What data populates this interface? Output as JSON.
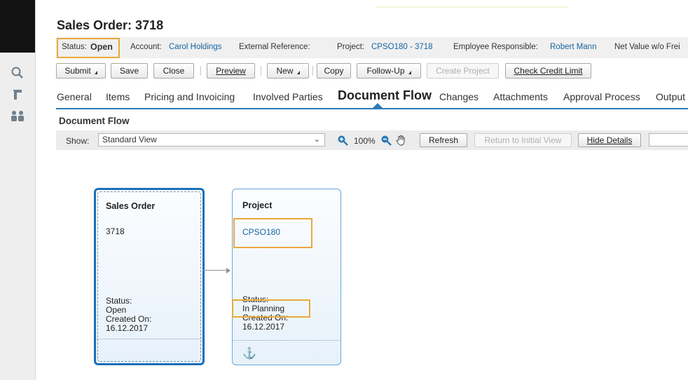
{
  "page": {
    "title": "Sales Order: 3718"
  },
  "status_bar": {
    "status_label": "Status:",
    "status_value": "Open",
    "account_label": "Account:",
    "account_value": "Carol Holdings",
    "external_ref_label": "External Reference:",
    "project_label": "Project:",
    "project_value": "CPSO180 - 3718",
    "employee_label": "Employee Responsible:",
    "employee_value": "Robert Mann",
    "net_value_label": "Net Value w/o Frei"
  },
  "toolbar": {
    "submit": "Submit",
    "save": "Save",
    "close": "Close",
    "preview": "Preview",
    "new": "New",
    "copy": "Copy",
    "follow_up": "Follow-Up",
    "create_project": "Create Project",
    "check_credit_limit": "Check Credit Limit"
  },
  "tabs": [
    "General",
    "Items",
    "Pricing and Invoicing",
    "Involved Parties",
    "Document Flow",
    "Changes",
    "Attachments",
    "Approval Process",
    "Output"
  ],
  "active_tab": "Document Flow",
  "section": {
    "title": "Document Flow"
  },
  "view_bar": {
    "show_label": "Show:",
    "view_selected": "Standard View",
    "zoom": "100%",
    "refresh": "Refresh",
    "return_initial": "Return to Initial View",
    "hide_details": "Hide Details"
  },
  "flow_cards": {
    "sales_order": {
      "title": "Sales Order",
      "id": "3718",
      "status_label": "Status:",
      "status": "Open",
      "created_label": "Created On:",
      "created": "16.12.2017"
    },
    "project": {
      "title": "Project",
      "id": "CPSO180",
      "status_label": "Status:",
      "status": "In Planning",
      "created_label": "Created On:",
      "created": "16.12.2017"
    }
  },
  "colors": {
    "accent": "#2c7bb6",
    "link": "#1464a0",
    "highlight": "#e8a93a",
    "selected_card_border": "#1d70b7"
  },
  "icons": [
    "search-icon",
    "back-arrow-icon",
    "people-icon",
    "zoom-in-icon",
    "zoom-out-icon",
    "hand-pan-icon",
    "anchor-icon",
    "chevron-down-icon"
  ]
}
